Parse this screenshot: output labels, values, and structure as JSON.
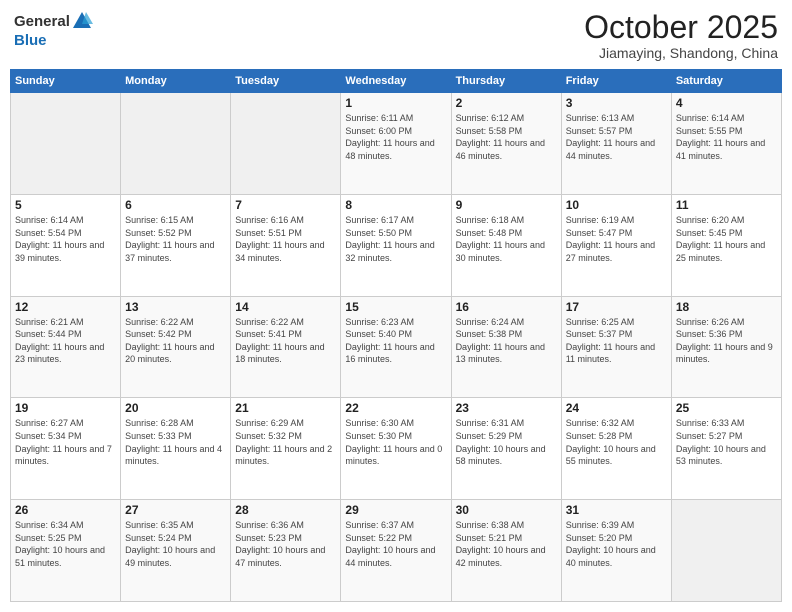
{
  "header": {
    "logo_general": "General",
    "logo_blue": "Blue",
    "month": "October 2025",
    "location": "Jiamaying, Shandong, China"
  },
  "days_of_week": [
    "Sunday",
    "Monday",
    "Tuesday",
    "Wednesday",
    "Thursday",
    "Friday",
    "Saturday"
  ],
  "weeks": [
    [
      {
        "day": "",
        "info": ""
      },
      {
        "day": "",
        "info": ""
      },
      {
        "day": "",
        "info": ""
      },
      {
        "day": "1",
        "info": "Sunrise: 6:11 AM\nSunset: 6:00 PM\nDaylight: 11 hours and 48 minutes."
      },
      {
        "day": "2",
        "info": "Sunrise: 6:12 AM\nSunset: 5:58 PM\nDaylight: 11 hours and 46 minutes."
      },
      {
        "day": "3",
        "info": "Sunrise: 6:13 AM\nSunset: 5:57 PM\nDaylight: 11 hours and 44 minutes."
      },
      {
        "day": "4",
        "info": "Sunrise: 6:14 AM\nSunset: 5:55 PM\nDaylight: 11 hours and 41 minutes."
      }
    ],
    [
      {
        "day": "5",
        "info": "Sunrise: 6:14 AM\nSunset: 5:54 PM\nDaylight: 11 hours and 39 minutes."
      },
      {
        "day": "6",
        "info": "Sunrise: 6:15 AM\nSunset: 5:52 PM\nDaylight: 11 hours and 37 minutes."
      },
      {
        "day": "7",
        "info": "Sunrise: 6:16 AM\nSunset: 5:51 PM\nDaylight: 11 hours and 34 minutes."
      },
      {
        "day": "8",
        "info": "Sunrise: 6:17 AM\nSunset: 5:50 PM\nDaylight: 11 hours and 32 minutes."
      },
      {
        "day": "9",
        "info": "Sunrise: 6:18 AM\nSunset: 5:48 PM\nDaylight: 11 hours and 30 minutes."
      },
      {
        "day": "10",
        "info": "Sunrise: 6:19 AM\nSunset: 5:47 PM\nDaylight: 11 hours and 27 minutes."
      },
      {
        "day": "11",
        "info": "Sunrise: 6:20 AM\nSunset: 5:45 PM\nDaylight: 11 hours and 25 minutes."
      }
    ],
    [
      {
        "day": "12",
        "info": "Sunrise: 6:21 AM\nSunset: 5:44 PM\nDaylight: 11 hours and 23 minutes."
      },
      {
        "day": "13",
        "info": "Sunrise: 6:22 AM\nSunset: 5:42 PM\nDaylight: 11 hours and 20 minutes."
      },
      {
        "day": "14",
        "info": "Sunrise: 6:22 AM\nSunset: 5:41 PM\nDaylight: 11 hours and 18 minutes."
      },
      {
        "day": "15",
        "info": "Sunrise: 6:23 AM\nSunset: 5:40 PM\nDaylight: 11 hours and 16 minutes."
      },
      {
        "day": "16",
        "info": "Sunrise: 6:24 AM\nSunset: 5:38 PM\nDaylight: 11 hours and 13 minutes."
      },
      {
        "day": "17",
        "info": "Sunrise: 6:25 AM\nSunset: 5:37 PM\nDaylight: 11 hours and 11 minutes."
      },
      {
        "day": "18",
        "info": "Sunrise: 6:26 AM\nSunset: 5:36 PM\nDaylight: 11 hours and 9 minutes."
      }
    ],
    [
      {
        "day": "19",
        "info": "Sunrise: 6:27 AM\nSunset: 5:34 PM\nDaylight: 11 hours and 7 minutes."
      },
      {
        "day": "20",
        "info": "Sunrise: 6:28 AM\nSunset: 5:33 PM\nDaylight: 11 hours and 4 minutes."
      },
      {
        "day": "21",
        "info": "Sunrise: 6:29 AM\nSunset: 5:32 PM\nDaylight: 11 hours and 2 minutes."
      },
      {
        "day": "22",
        "info": "Sunrise: 6:30 AM\nSunset: 5:30 PM\nDaylight: 11 hours and 0 minutes."
      },
      {
        "day": "23",
        "info": "Sunrise: 6:31 AM\nSunset: 5:29 PM\nDaylight: 10 hours and 58 minutes."
      },
      {
        "day": "24",
        "info": "Sunrise: 6:32 AM\nSunset: 5:28 PM\nDaylight: 10 hours and 55 minutes."
      },
      {
        "day": "25",
        "info": "Sunrise: 6:33 AM\nSunset: 5:27 PM\nDaylight: 10 hours and 53 minutes."
      }
    ],
    [
      {
        "day": "26",
        "info": "Sunrise: 6:34 AM\nSunset: 5:25 PM\nDaylight: 10 hours and 51 minutes."
      },
      {
        "day": "27",
        "info": "Sunrise: 6:35 AM\nSunset: 5:24 PM\nDaylight: 10 hours and 49 minutes."
      },
      {
        "day": "28",
        "info": "Sunrise: 6:36 AM\nSunset: 5:23 PM\nDaylight: 10 hours and 47 minutes."
      },
      {
        "day": "29",
        "info": "Sunrise: 6:37 AM\nSunset: 5:22 PM\nDaylight: 10 hours and 44 minutes."
      },
      {
        "day": "30",
        "info": "Sunrise: 6:38 AM\nSunset: 5:21 PM\nDaylight: 10 hours and 42 minutes."
      },
      {
        "day": "31",
        "info": "Sunrise: 6:39 AM\nSunset: 5:20 PM\nDaylight: 10 hours and 40 minutes."
      },
      {
        "day": "",
        "info": ""
      }
    ]
  ]
}
